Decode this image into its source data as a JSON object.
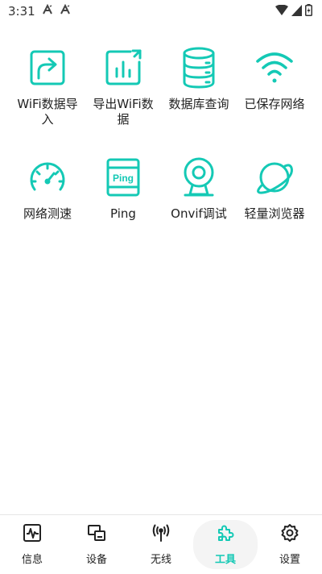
{
  "colors": {
    "accent": "#14c9b5",
    "text": "#222222",
    "nav_active_bg": "#f4f4f4"
  },
  "status_bar": {
    "time": "3:31"
  },
  "tools": [
    {
      "label": "WiFi数据导入",
      "icon": "wifi-import-icon"
    },
    {
      "label": "导出WiFi数据",
      "icon": "wifi-export-icon"
    },
    {
      "label": "数据库查询",
      "icon": "database-icon"
    },
    {
      "label": "已保存网络",
      "icon": "wifi-icon"
    },
    {
      "label": "网络测速",
      "icon": "speedometer-icon"
    },
    {
      "label": "Ping",
      "icon": "ping-icon"
    },
    {
      "label": "Onvif调试",
      "icon": "webcam-icon"
    },
    {
      "label": "轻量浏览器",
      "icon": "planet-icon"
    }
  ],
  "bottom_nav": [
    {
      "label": "信息",
      "icon": "pulse-icon",
      "active": false
    },
    {
      "label": "设备",
      "icon": "devices-icon",
      "active": false
    },
    {
      "label": "无线",
      "icon": "antenna-icon",
      "active": false
    },
    {
      "label": "工具",
      "icon": "puzzle-icon",
      "active": true
    },
    {
      "label": "设置",
      "icon": "gear-icon",
      "active": false
    }
  ]
}
